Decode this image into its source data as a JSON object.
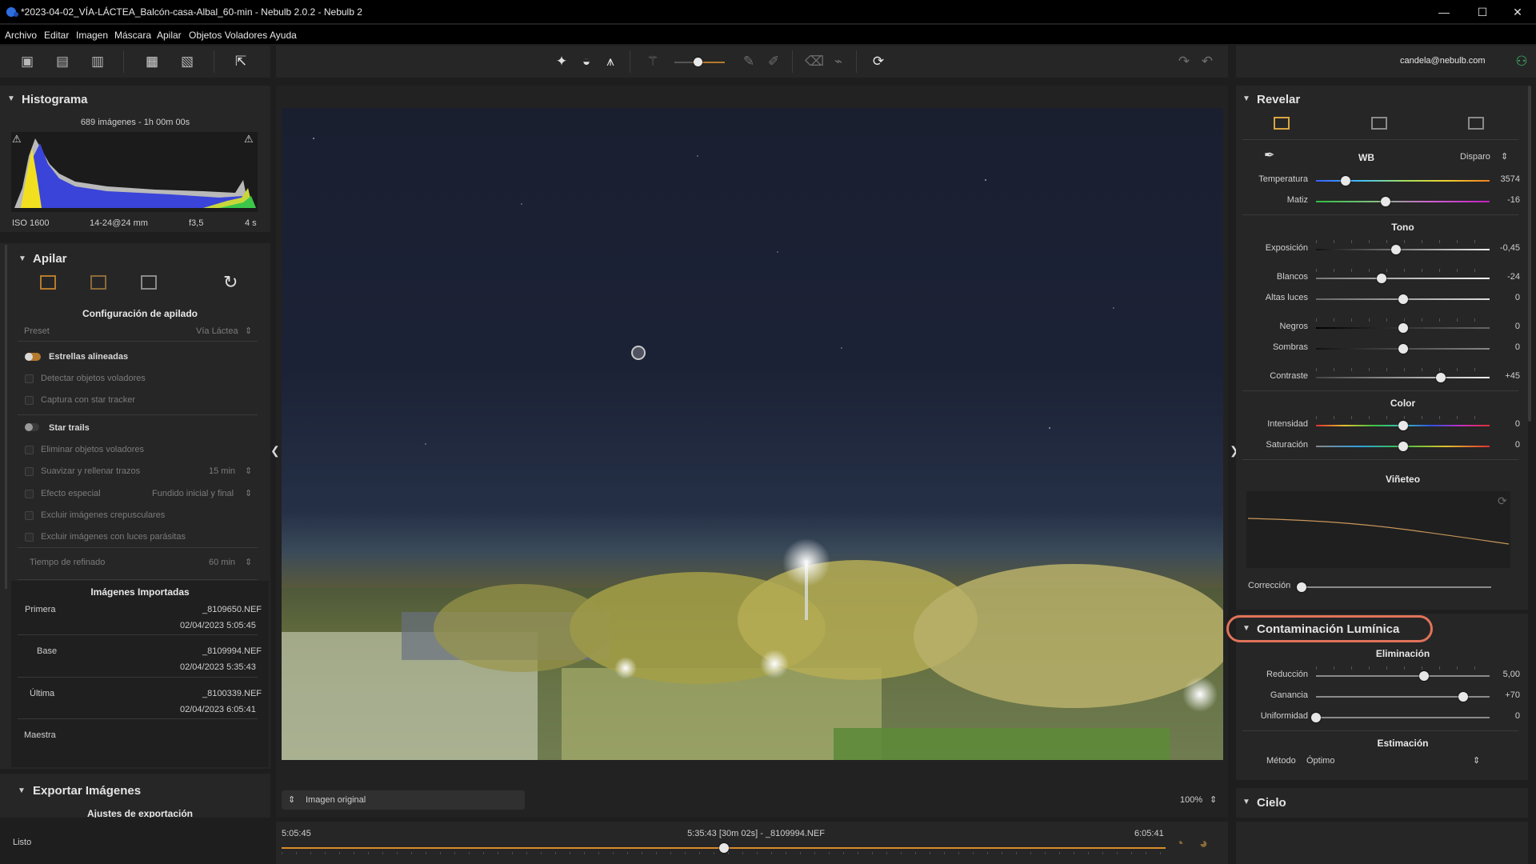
{
  "window": {
    "title": "*2023-04-02_VÍA-LÁCTEA_Balcón-casa-Albal_60-min - Nebulb 2.0.2 - Nebulb 2",
    "minimize_glyph": "—",
    "maximize_glyph": "☐",
    "close_glyph": "✕"
  },
  "menu": [
    "Archivo",
    "Editar",
    "Imagen",
    "Máscara",
    "Apilar",
    "Objetos Voladores",
    "Ayuda"
  ],
  "account": {
    "email": "candela@nebulb.com"
  },
  "histogram": {
    "title": "Histograma",
    "summary": "689 imágenes - 1h 00m 00s",
    "iso": "ISO 1600",
    "lens": "14-24@24 mm",
    "aperture": "f3,5",
    "shutter": "4 s"
  },
  "stack": {
    "title": "Apilar",
    "config_title": "Configuración de apilado",
    "preset_label": "Preset",
    "preset_value": "Vía Láctea",
    "aligned_stars": "Estrellas alineadas",
    "detect_flying": "Detectar objetos voladores",
    "star_tracker": "Captura con star tracker",
    "star_trails": "Star trails",
    "remove_flying": "Eliminar objetos voladores",
    "smooth_fill": "Suavizar y rellenar trazos",
    "smooth_fill_value": "15 min",
    "special_effect": "Efecto especial",
    "special_effect_value": "Fundido inicial y final",
    "exclude_twilight": "Excluir imágenes crepusculares",
    "exclude_stray": "Excluir imágenes con luces parásitas",
    "refine_time": "Tiempo de refinado",
    "refine_time_value": "60 min",
    "imported_title": "Imágenes Importadas",
    "first_label": "Primera",
    "first_file": "_8109650.NEF",
    "first_date": "02/04/2023 5:05:45",
    "base_label": "Base",
    "base_file": "_8109994.NEF",
    "base_date": "02/04/2023 5:35:43",
    "last_label": "Última",
    "last_file": "_8100339.NEF",
    "last_date": "02/04/2023 6:05:41",
    "master_label": "Maestra"
  },
  "export": {
    "title": "Exportar Imágenes",
    "settings": "Ajustes de exportación"
  },
  "status": {
    "text": "Listo"
  },
  "viewer": {
    "mode": "Imagen original",
    "zoom": "100%"
  },
  "timeline": {
    "start": "5:05:45",
    "current": "5:35:43 [30m 02s] - _8109994.NEF",
    "end": "6:05:41",
    "position_fraction": 0.5
  },
  "develop": {
    "title": "Revelar",
    "wb_label": "WB",
    "wb_mode": "Disparo",
    "temp_label": "Temperatura",
    "temp_value": "3574",
    "temp_pos": 0.17,
    "tint_label": "Matiz",
    "tint_value": "-16",
    "tint_pos": 0.4,
    "tone_title": "Tono",
    "exposure_label": "Exposición",
    "exposure_value": "-0,45",
    "exposure_pos": 0.46,
    "whites_label": "Blancos",
    "whites_value": "-24",
    "whites_pos": 0.38,
    "highlights_label": "Altas luces",
    "highlights_value": "0",
    "highlights_pos": 0.5,
    "blacks_label": "Negros",
    "blacks_value": "0",
    "blacks_pos": 0.5,
    "shadows_label": "Sombras",
    "shadows_value": "0",
    "shadows_pos": 0.5,
    "contrast_label": "Contraste",
    "contrast_value": "+45",
    "contrast_pos": 0.72,
    "color_title": "Color",
    "intensity_label": "Intensidad",
    "intensity_value": "0",
    "intensity_pos": 0.5,
    "saturation_label": "Saturación",
    "saturation_value": "0",
    "saturation_pos": 0.5,
    "vignette_title": "Viñeteo",
    "correction_label": "Corrección",
    "correction_pos": 0.0
  },
  "light_pollution": {
    "title": "Contaminación Lumínica",
    "removal_title": "Eliminación",
    "reduction_label": "Reducción",
    "reduction_value": "5,00",
    "reduction_pos": 0.62,
    "gain_label": "Ganancia",
    "gain_value": "+70",
    "gain_pos": 0.85,
    "uniformity_label": "Uniformidad",
    "uniformity_value": "0",
    "uniformity_pos": 0.0,
    "estimation_title": "Estimación",
    "method_label": "Método",
    "method_value": "Óptimo"
  },
  "sky": {
    "title": "Cielo"
  },
  "colors": {
    "accent": "#d9a441",
    "highlight_ring": "#e0735a",
    "background": "#1e1e1e",
    "panel": "#262626"
  }
}
